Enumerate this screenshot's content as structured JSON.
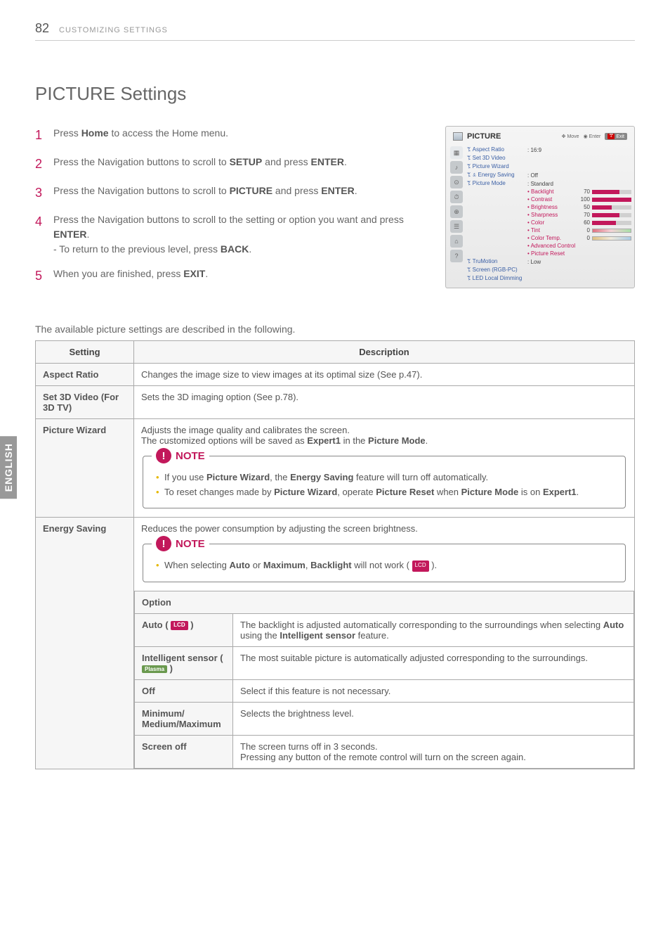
{
  "header": {
    "pageNumber": "82",
    "section": "CUSTOMIZING SETTINGS"
  },
  "sideTab": "ENGLISH",
  "heading": "PICTURE Settings",
  "steps": [
    {
      "num": "1",
      "html": "Press <b>Home</b> to access the Home menu."
    },
    {
      "num": "2",
      "html": "Press the Navigation buttons to scroll to <b>SETUP</b> and press <b>ENTER</b>."
    },
    {
      "num": "3",
      "html": "Press the Navigation buttons to scroll to <b>PICTURE</b> and press <b>ENTER</b>."
    },
    {
      "num": "4",
      "html": "Press the Navigation buttons to scroll to the setting or option you want and press <b>ENTER</b>.<br>- To return to the previous level, press <b>BACK</b>."
    },
    {
      "num": "5",
      "html": "When you are finished, press <b>EXIT</b>."
    }
  ],
  "osd": {
    "title": "PICTURE",
    "move": "Move",
    "enter": "Enter",
    "exit": "Exit",
    "items": [
      {
        "label": "ꔂ Aspect Ratio",
        "value": ": 16:9"
      },
      {
        "label": "ꔂ Set 3D Video",
        "value": ""
      },
      {
        "label": "ꔂ Picture Wizard",
        "value": ""
      },
      {
        "label": "ꔂ ꕊ Energy Saving",
        "value": ": Off"
      },
      {
        "label": "ꔂ Picture Mode",
        "value": ": Standard"
      }
    ],
    "sliders": [
      {
        "name": "Backlight",
        "val": "70",
        "pct": 70
      },
      {
        "name": "Contrast",
        "val": "100",
        "pct": 100
      },
      {
        "name": "Brightness",
        "val": "50",
        "pct": 50
      },
      {
        "name": "Sharpness",
        "val": "70",
        "pct": 70
      },
      {
        "name": "Color",
        "val": "60",
        "pct": 60
      }
    ],
    "tint": {
      "name": "Tint",
      "val": "0",
      "left": "R",
      "right": "G"
    },
    "colortemp": {
      "name": "Color Temp.",
      "val": "0",
      "left": "W",
      "right": "C"
    },
    "extras": [
      "Advanced Control",
      "Picture Reset"
    ],
    "bottom": [
      {
        "label": "ꔂ TruMotion",
        "value": ": Low"
      },
      {
        "label": "ꔂ Screen (RGB-PC)",
        "value": ""
      },
      {
        "label": "ꔂ LED Local Dimming",
        "value": ""
      }
    ]
  },
  "tableIntro": "The available picture settings are described in the following.",
  "table": {
    "headers": {
      "setting": "Setting",
      "description": "Description"
    },
    "rows": {
      "aspect": {
        "name": "Aspect Ratio",
        "desc": "Changes the image size to view images at its optimal size (See p.47)."
      },
      "set3d": {
        "name": "Set 3D Video (For 3D TV)",
        "desc": "Sets the 3D imaging option (See p.78)."
      },
      "wizard": {
        "name": "Picture Wizard",
        "desc": "Adjusts the image quality and calibrates the screen.\nThe customized options will be saved as <b>Expert1</b> in the <b>Picture Mode</b>.",
        "note": [
          "If you use <b>Picture Wizard</b>, the <b>Energy Saving</b> feature will turn off automatically.",
          "To reset changes made by <b>Picture Wizard</b>, operate <b>Picture Reset</b> when <b>Picture Mode</b> is on <b>Expert1</b>."
        ]
      },
      "energy": {
        "name": "Energy Saving",
        "desc": "Reduces the power consumption by adjusting the screen brightness.",
        "note": [
          "When selecting <b>Auto</b> or <b>Maximum</b>, <b>Backlight</b> will not work ( <span class='lcd-badge'>LCD</span> )."
        ],
        "optionHeader": "Option",
        "options": [
          {
            "name": "Auto ( <span class='lcd-badge'>LCD</span> )",
            "desc": "The backlight is adjusted automatically corresponding to the surroundings when selecting <b>Auto</b> using the <b>Intelligent sensor</b> feature."
          },
          {
            "name": "Intelligent sensor ( <span class='plasma-badge'>Plasma</span> )",
            "desc": "The most suitable picture is automatically adjusted corresponding to the surroundings."
          },
          {
            "name": "Off",
            "desc": "Select if this feature is not necessary."
          },
          {
            "name": "Minimum/ Medium/Maximum",
            "desc": "Selects the brightness level."
          },
          {
            "name": "Screen off",
            "desc": "The screen turns off in 3 seconds.\nPressing any button of the remote control will turn on the screen again."
          }
        ]
      }
    },
    "noteLabel": "NOTE"
  }
}
